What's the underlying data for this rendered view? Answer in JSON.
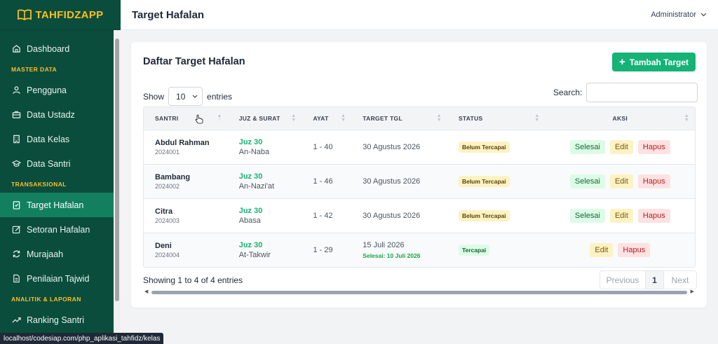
{
  "brand": {
    "name": "TAHFIDZAPP"
  },
  "sidebar": {
    "items": [
      {
        "label": "Dashboard",
        "icon": "home-icon"
      },
      {
        "section": "MASTER DATA"
      },
      {
        "label": "Pengguna",
        "icon": "users-icon"
      },
      {
        "label": "Data Ustadz",
        "icon": "briefcase-icon"
      },
      {
        "label": "Data Kelas",
        "icon": "building-icon"
      },
      {
        "label": "Data Santri",
        "icon": "graduation-cap-icon"
      },
      {
        "section": "TRANSAKSIONAL"
      },
      {
        "label": "Target Hafalan",
        "icon": "clipboard-check-icon",
        "active": true
      },
      {
        "label": "Setoran Hafalan",
        "icon": "edit-icon"
      },
      {
        "label": "Murajaah",
        "icon": "refresh-icon"
      },
      {
        "label": "Penilaian Tajwid",
        "icon": "document-icon"
      },
      {
        "section": "ANALITIK & LAPORAN"
      },
      {
        "label": "Ranking Santri",
        "icon": "trending-up-icon"
      }
    ]
  },
  "header": {
    "title": "Target Hafalan",
    "user": "Administrator"
  },
  "card": {
    "title": "Daftar Target Hafalan",
    "add_button": "Tambah Target",
    "show_label": "Show",
    "entries_label": "entries",
    "page_size": "10",
    "search_label": "Search:",
    "search_value": ""
  },
  "table": {
    "columns": [
      "SANTRI",
      "JUZ & SURAT",
      "AYAT",
      "TARGET TGL",
      "STATUS",
      "AKSI"
    ],
    "rows": [
      {
        "name": "Abdul Rahman",
        "nis": "2024001",
        "juz": "Juz 30",
        "surat": "An-Naba",
        "ayat": "1 - 40",
        "target": "30 Agustus 2026",
        "done_note": "",
        "status": "Belum Tercapai",
        "status_type": "pending",
        "actions": [
          "Selesai",
          "Edit",
          "Hapus"
        ]
      },
      {
        "name": "Bambang",
        "nis": "2024002",
        "juz": "Juz 30",
        "surat": "An-Nazi'at",
        "ayat": "1 - 46",
        "target": "30 Agustus 2026",
        "done_note": "",
        "status": "Belum Tercapai",
        "status_type": "pending",
        "actions": [
          "Selesai",
          "Edit",
          "Hapus"
        ]
      },
      {
        "name": "Citra",
        "nis": "2024003",
        "juz": "Juz 30",
        "surat": "Abasa",
        "ayat": "1 - 42",
        "target": "30 Agustus 2026",
        "done_note": "",
        "status": "Belum Tercapai",
        "status_type": "pending",
        "actions": [
          "Selesai",
          "Edit",
          "Hapus"
        ]
      },
      {
        "name": "Deni",
        "nis": "2024004",
        "juz": "Juz 30",
        "surat": "At-Takwir",
        "ayat": "1 - 29",
        "target": "15 Juli 2026",
        "done_note": "Selesai: 10 Juli 2026",
        "status": "Tercapai",
        "status_type": "done",
        "actions": [
          "Edit",
          "Hapus"
        ]
      }
    ]
  },
  "footer": {
    "info": "Showing 1 to 4 of 4 entries",
    "prev": "Previous",
    "page": "1",
    "next": "Next"
  },
  "statusbar": {
    "url": "localhost/codesiap.com/php_aplikasi_tahfidz/kelas"
  },
  "colors": {
    "sidebar": "#0b4d3c",
    "active": "#12805f",
    "accent": "#16b377",
    "section": "#fbbf24"
  }
}
